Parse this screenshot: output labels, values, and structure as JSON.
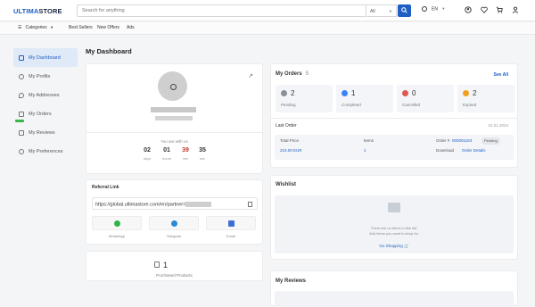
{
  "header": {
    "logo_a": "ULTIMA",
    "logo_b": "STORE",
    "search_placeholder": "Search for anything",
    "category_selected": "All",
    "language": "EN"
  },
  "nav": {
    "categories": "Categories",
    "best_sellers": "Best Sellers",
    "new_offers": "New Offers",
    "ads": "Ads"
  },
  "sidebar": {
    "items": [
      {
        "label": "My Dashboard",
        "icon": "dashboard-icon",
        "active": true
      },
      {
        "label": "My Profile",
        "icon": "profile-icon"
      },
      {
        "label": "My Addresses",
        "icon": "location-icon"
      },
      {
        "label": "My Orders",
        "icon": "orders-icon"
      },
      {
        "label": "My Reviews",
        "icon": "reviews-icon"
      },
      {
        "label": "My Preferences",
        "icon": "gear-icon"
      }
    ]
  },
  "page_title": "My Dashboard",
  "profile": {
    "since_label": "You are with us",
    "countdown": [
      {
        "value": "02",
        "unit": "days"
      },
      {
        "value": "01",
        "unit": "hours"
      },
      {
        "value": "39",
        "unit": "min"
      },
      {
        "value": "35",
        "unit": "sec"
      }
    ]
  },
  "referral": {
    "heading": "Referral Link",
    "link": "https://global.ultimastore.com/en/partner=",
    "share": [
      {
        "label": "WhatsApp",
        "color": "#2fb34a"
      },
      {
        "label": "Telegram",
        "color": "#2a8ad6"
      },
      {
        "label": "Email",
        "color": "#3b6fd6"
      }
    ]
  },
  "purchased": {
    "count": "1",
    "label": "Purchased Products"
  },
  "orders": {
    "heading": "My Orders",
    "count": "5",
    "see_all": "See All",
    "stats": [
      {
        "value": "2",
        "label": "Pending",
        "color": "#8a8f98"
      },
      {
        "value": "1",
        "label": "Completed",
        "color": "#3b82f6"
      },
      {
        "value": "0",
        "label": "Cancelled",
        "color": "#e05555"
      },
      {
        "value": "2",
        "label": "Expired",
        "color": "#f0a020"
      }
    ],
    "last_order_label": "Last Order",
    "last_order_date": "31.01.2024",
    "total_price_label": "Total Price",
    "total_price": "210.00 EUR",
    "items_label": "Items",
    "items": "1",
    "order_no_label": "Order #",
    "order_no": "000001183",
    "status": "Pending",
    "download": "Download",
    "order_details": "Order Details"
  },
  "wishlist": {
    "heading": "Wishlist",
    "empty_line1": "There are no items in this list.",
    "empty_line2": "Add items you want to shop for.",
    "go_shopping": "Go Shopping"
  },
  "reviews": {
    "heading": "My Reviews"
  }
}
